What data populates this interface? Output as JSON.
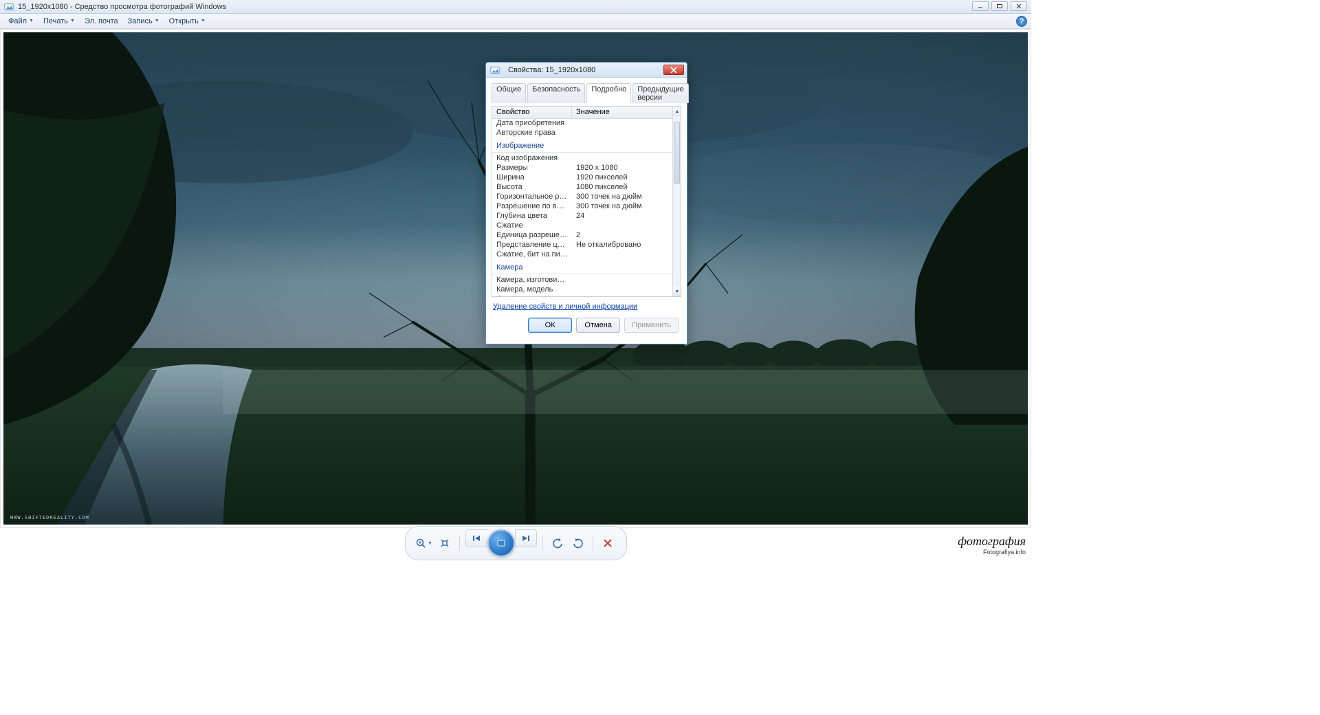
{
  "window": {
    "title": "15_1920x1080 - Средство просмотра фотографий Windows"
  },
  "menu": {
    "file": "Файл",
    "print": "Печать",
    "email": "Эл. почта",
    "burn": "Запись",
    "open": "Открыть"
  },
  "help_icon": "?",
  "watermarks": {
    "left": "WWW.SHIFTEDREALITY.COM",
    "right_script": "фотография",
    "right_sub": "Fotografiya.info"
  },
  "dialog": {
    "title": "Свойства: 15_1920x1080",
    "tabs": {
      "general": "Общие",
      "security": "Безопасность",
      "details": "Подробно",
      "versions": "Предыдущие версии"
    },
    "columns": {
      "property": "Свойство",
      "value": "Значение"
    },
    "rows": {
      "date_acquired": "Дата приобретения",
      "copyright": "Авторские права",
      "section_image": "Изображение",
      "image_id": "Код изображения",
      "dimensions_k": "Размеры",
      "dimensions_v": "1920 x 1080",
      "width_k": "Ширина",
      "width_v": "1920 пикселей",
      "height_k": "Высота",
      "height_v": "1080 пикселей",
      "hres_k": "Горизонтальное разреше...",
      "hres_v": "300 точек на дюйм",
      "vres_k": "Разрешение по вертикали",
      "vres_v": "300 точек на дюйм",
      "bitdepth_k": "Глубина цвета",
      "bitdepth_v": "24",
      "compression_k": "Сжатие",
      "resunit_k": "Единица разрешения",
      "resunit_v": "2",
      "colorrep_k": "Представление цвета",
      "colorrep_v": "Не откалибровано",
      "bpp_k": "Сжатие, бит на пиксель",
      "section_camera": "Камера",
      "cammake_k": "Камера, изготовитель",
      "cammodel_k": "Камера, модель",
      "aperture_k": "Диафрагма"
    },
    "remove_link": "Удаление свойств и личной информации",
    "buttons": {
      "ok": "ОК",
      "cancel": "Отмена",
      "apply": "Применить"
    }
  }
}
